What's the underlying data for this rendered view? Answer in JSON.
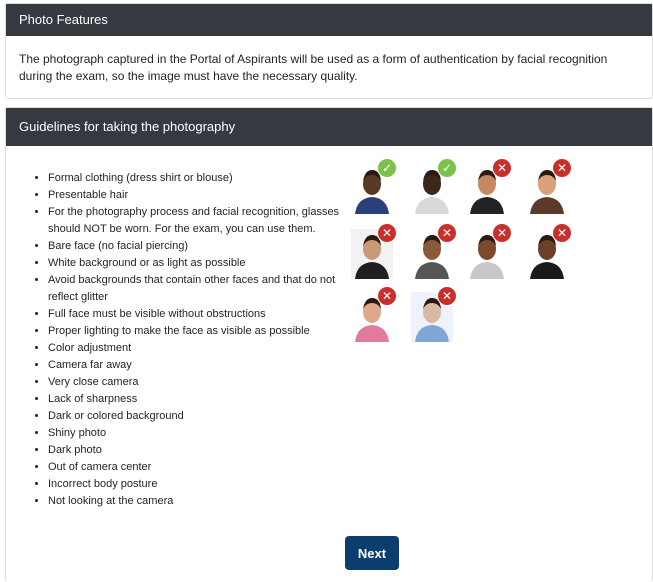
{
  "photo_features": {
    "title": "Photo Features",
    "description": "The photograph captured in the Portal of Aspirants will be used as a form of authentication by facial recognition during the exam, so the image must have the necessary quality."
  },
  "guidelines": {
    "title": "Guidelines for taking the photography",
    "items": [
      "Formal clothing (dress shirt or blouse)",
      "Presentable hair",
      "For the photography process and facial recognition, glasses should NOT be worn. For the exam, you can use them.",
      "Bare face (no facial piercing)",
      "White background or as light as possible",
      "Avoid backgrounds that contain other faces and that do not reflect glitter",
      "Full face must be visible without obstructions",
      "Proper lighting to make the face as visible as possible",
      "Color adjustment",
      "Camera far away",
      "Very close camera",
      "Lack of sharpness",
      "Dark or colored background",
      "Shiny photo",
      "Dark photo",
      "Out of camera center",
      "Incorrect body posture",
      "Not looking at the camera"
    ]
  },
  "examples": [
    {
      "status": "accepted",
      "mark": "✓",
      "icon": "accepted-photo-icon",
      "skin": "#5a3a25",
      "bg": "#ffffff",
      "cloth": "#2b3f7a"
    },
    {
      "status": "accepted",
      "mark": "✓",
      "icon": "accepted-photo-icon",
      "skin": "#3e2618",
      "bg": "#ffffff",
      "cloth": "#d9d9d9"
    },
    {
      "status": "rejected",
      "mark": "✕",
      "icon": "rejected-photo-icon",
      "skin": "#c68a62",
      "bg": "#ffffff",
      "cloth": "#222222"
    },
    {
      "status": "rejected",
      "mark": "✕",
      "icon": "rejected-photo-icon",
      "skin": "#d9a07a",
      "bg": "#ffffff",
      "cloth": "#5a3b2a"
    },
    {
      "status": "rejected",
      "mark": "✕",
      "icon": "rejected-photo-icon",
      "skin": "#c99a78",
      "bg": "#f2f2f2",
      "cloth": "#1f1f1f"
    },
    {
      "status": "rejected",
      "mark": "✕",
      "icon": "rejected-photo-icon",
      "skin": "#8a5a3a",
      "bg": "#ffffff",
      "cloth": "#555555"
    },
    {
      "status": "rejected",
      "mark": "✕",
      "icon": "rejected-photo-icon",
      "skin": "#7a4a2e",
      "bg": "#ffffff",
      "cloth": "#c8c8c8"
    },
    {
      "status": "rejected",
      "mark": "✕",
      "icon": "rejected-photo-icon",
      "skin": "#6a4028",
      "bg": "#ffffff",
      "cloth": "#1a1a1a"
    },
    {
      "status": "rejected",
      "mark": "✕",
      "icon": "rejected-photo-icon",
      "skin": "#e0a88a",
      "bg": "#ffffff",
      "cloth": "#e27a9a"
    },
    {
      "status": "rejected",
      "mark": "✕",
      "icon": "rejected-photo-icon",
      "skin": "#d8b8a0",
      "bg": "#eef3fb",
      "cloth": "#7fa6d6"
    }
  ],
  "next_button": {
    "label": "Next"
  },
  "colors": {
    "header_bg": "#343a40",
    "accept_badge": "#7cc24a",
    "reject_badge": "#c9302c",
    "button_bg": "#0b3d6e"
  }
}
